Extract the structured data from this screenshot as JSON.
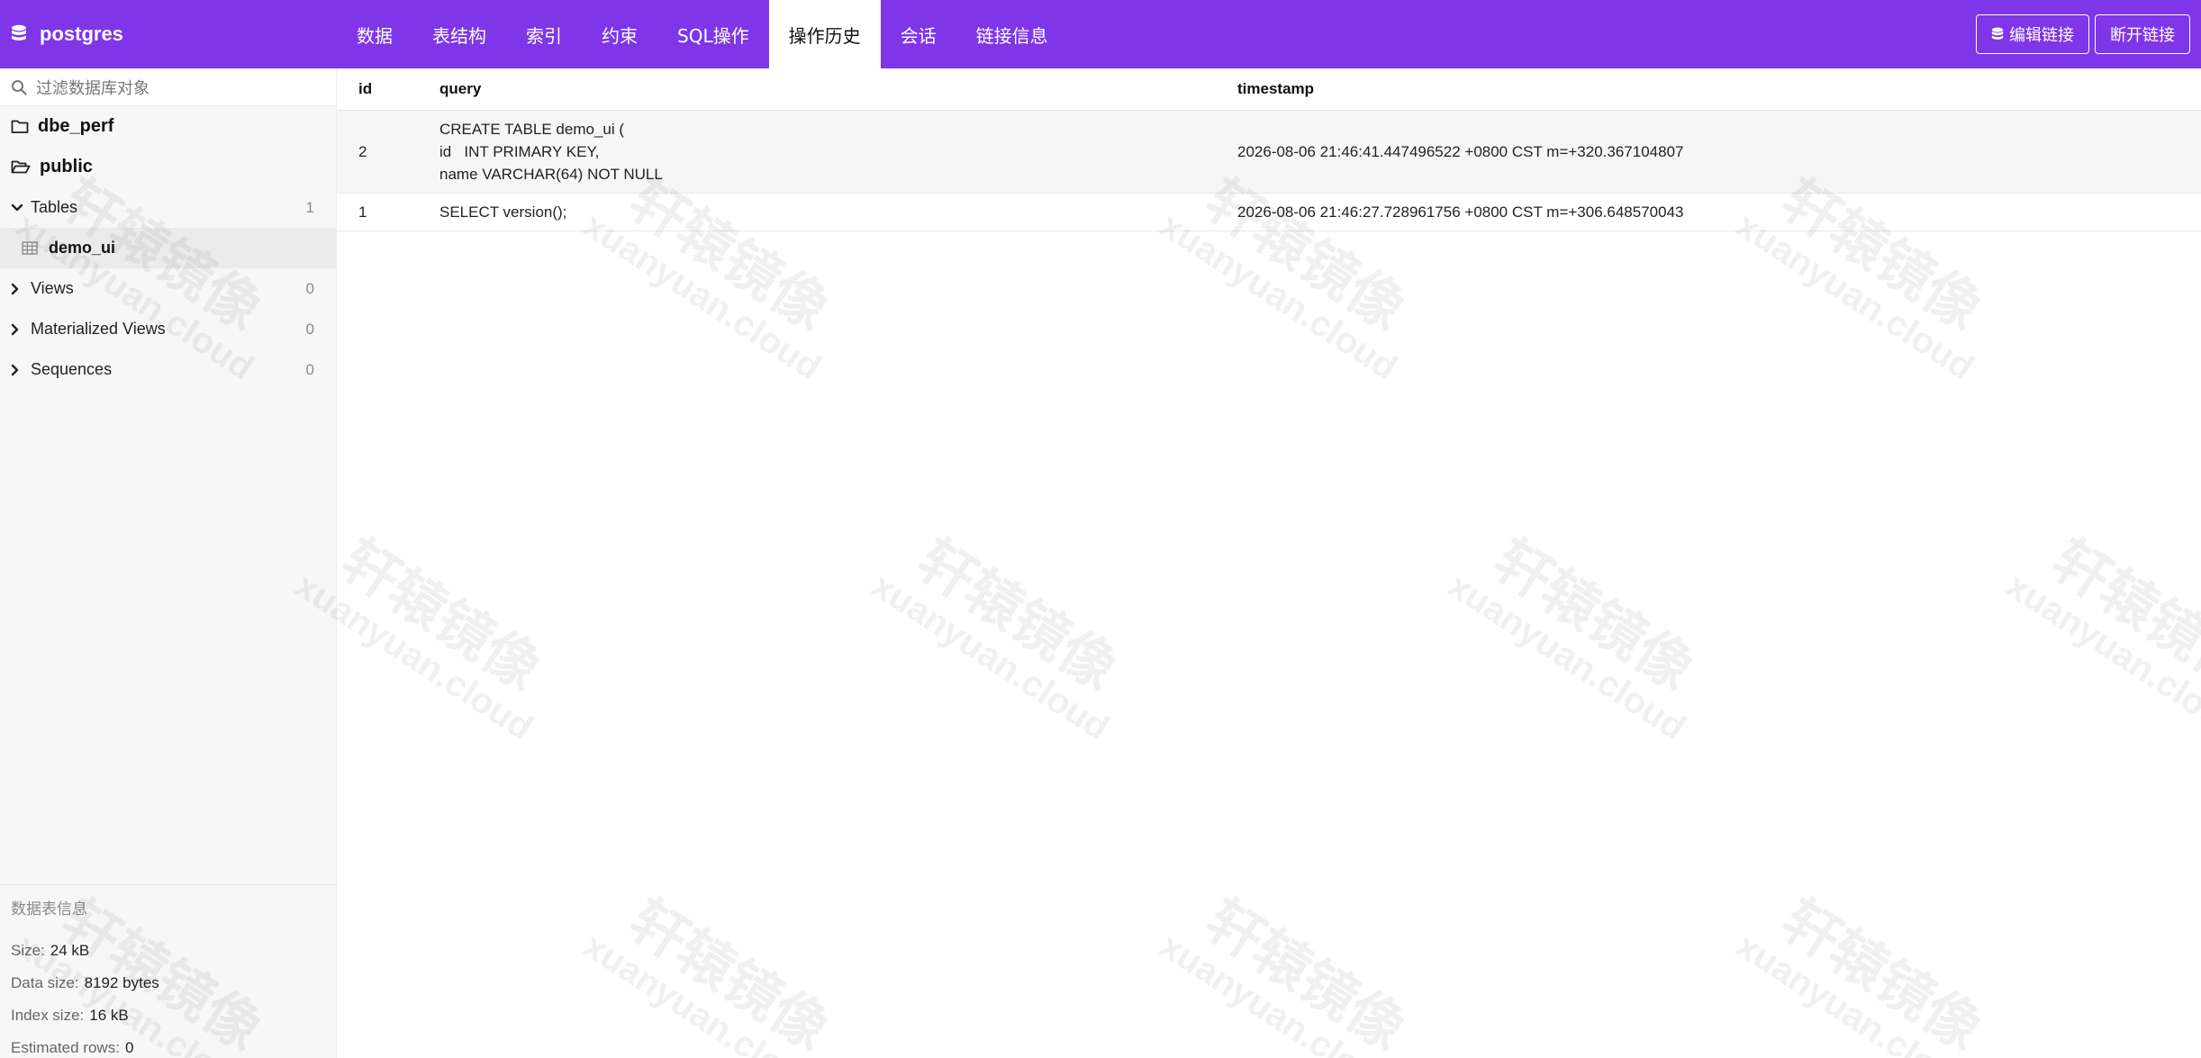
{
  "app": {
    "db_name": "postgres"
  },
  "tabs": [
    {
      "label": "数据",
      "active": false
    },
    {
      "label": "表结构",
      "active": false
    },
    {
      "label": "索引",
      "active": false
    },
    {
      "label": "约束",
      "active": false
    },
    {
      "label": "SQL操作",
      "active": false
    },
    {
      "label": "操作历史",
      "active": true
    },
    {
      "label": "会话",
      "active": false
    },
    {
      "label": "链接信息",
      "active": false
    }
  ],
  "actions": {
    "edit_label": "编辑链接",
    "disconnect_label": "断开链接"
  },
  "sidebar": {
    "filter_placeholder": "过滤数据库对象",
    "schemas": [
      "dbe_perf",
      "public"
    ],
    "groups": {
      "tables": {
        "label": "Tables",
        "count": "1"
      },
      "views": {
        "label": "Views",
        "count": "0"
      },
      "matviews": {
        "label": "Materialized Views",
        "count": "0"
      },
      "sequences": {
        "label": "Sequences",
        "count": "0"
      }
    },
    "tables": [
      "demo_ui"
    ],
    "info": {
      "title": "数据表信息",
      "size_key": "Size:",
      "size_val": "24 kB",
      "data_size_key": "Data size:",
      "data_size_val": "8192 bytes",
      "index_size_key": "Index size:",
      "index_size_val": "16 kB",
      "rows_key": "Estimated rows:",
      "rows_val": "0"
    }
  },
  "history": {
    "columns": [
      "id",
      "query",
      "timestamp"
    ],
    "rows": [
      {
        "id": "2",
        "query": [
          "CREATE TABLE demo_ui (",
          "id   INT PRIMARY KEY,",
          "name VARCHAR(64) NOT NULL"
        ],
        "timestamp": "2026-08-06 21:46:41.447496522 +0800 CST m=+320.367104807"
      },
      {
        "id": "1",
        "query": [
          "SELECT version();"
        ],
        "timestamp": "2026-08-06 21:46:27.728961756 +0800 CST m=+306.648570043"
      }
    ]
  },
  "watermark": {
    "line1": "轩辕镜像",
    "line2": "xuanyuan.cloud"
  },
  "colors": {
    "accent": "#7f35e8"
  }
}
